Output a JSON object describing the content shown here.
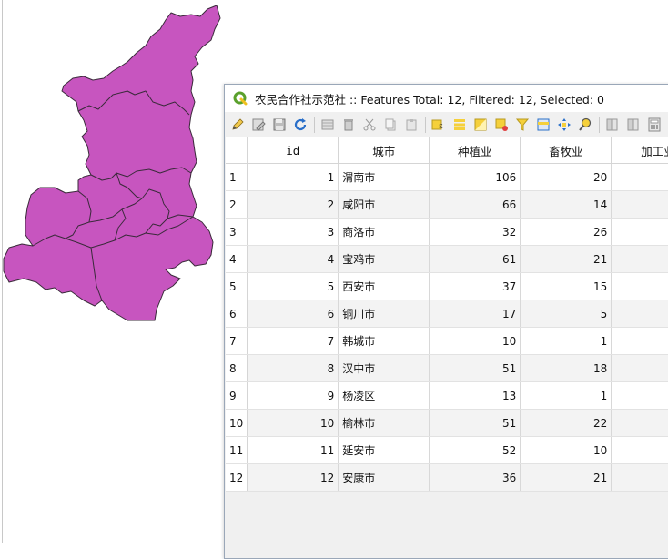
{
  "window": {
    "title": "农民合作社示范社 :: Features Total: 12, Filtered: 12, Selected: 0"
  },
  "toolbar": {
    "buttons": [
      {
        "icon": "pencil-toggle-edit-icon"
      },
      {
        "icon": "multi-edit-icon"
      },
      {
        "icon": "save-edits-icon"
      },
      {
        "icon": "reload-icon"
      },
      {
        "icon": "add-feature-icon"
      },
      {
        "icon": "delete-feature-icon"
      },
      {
        "icon": "cut-icon"
      },
      {
        "icon": "copy-icon"
      },
      {
        "icon": "paste-icon"
      },
      {
        "icon": "select-by-expression-icon"
      },
      {
        "icon": "select-all-icon"
      },
      {
        "icon": "invert-selection-icon"
      },
      {
        "icon": "deselect-all-icon"
      },
      {
        "icon": "filter-select-icon"
      },
      {
        "icon": "move-selection-top-icon"
      },
      {
        "icon": "pan-to-selection-icon"
      },
      {
        "icon": "zoom-to-selection-icon"
      },
      {
        "icon": "new-field-icon"
      },
      {
        "icon": "delete-field-icon"
      },
      {
        "icon": "field-calculator-icon"
      }
    ]
  },
  "table": {
    "columns": [
      "id",
      "城市",
      "种植业",
      "畜牧业",
      "加工业"
    ],
    "rows": [
      {
        "row_no": "1",
        "id": "1",
        "city": "渭南市",
        "planting": "106",
        "livestock": "20"
      },
      {
        "row_no": "2",
        "id": "2",
        "city": "咸阳市",
        "planting": "66",
        "livestock": "14"
      },
      {
        "row_no": "3",
        "id": "3",
        "city": "商洛市",
        "planting": "32",
        "livestock": "26"
      },
      {
        "row_no": "4",
        "id": "4",
        "city": "宝鸡市",
        "planting": "61",
        "livestock": "21"
      },
      {
        "row_no": "5",
        "id": "5",
        "city": "西安市",
        "planting": "37",
        "livestock": "15"
      },
      {
        "row_no": "6",
        "id": "6",
        "city": "铜川市",
        "planting": "17",
        "livestock": "5"
      },
      {
        "row_no": "7",
        "id": "7",
        "city": "韩城市",
        "planting": "10",
        "livestock": "1"
      },
      {
        "row_no": "8",
        "id": "8",
        "city": "汉中市",
        "planting": "51",
        "livestock": "18"
      },
      {
        "row_no": "9",
        "id": "9",
        "city": "杨凌区",
        "planting": "13",
        "livestock": "1"
      },
      {
        "row_no": "10",
        "id": "10",
        "city": "榆林市",
        "planting": "51",
        "livestock": "22"
      },
      {
        "row_no": "11",
        "id": "11",
        "city": "延安市",
        "planting": "52",
        "livestock": "10"
      },
      {
        "row_no": "12",
        "id": "12",
        "city": "安康市",
        "planting": "36",
        "livestock": "21"
      }
    ]
  },
  "map": {
    "fill_color": "#c755bf",
    "stroke_color": "#3a2a3a"
  }
}
